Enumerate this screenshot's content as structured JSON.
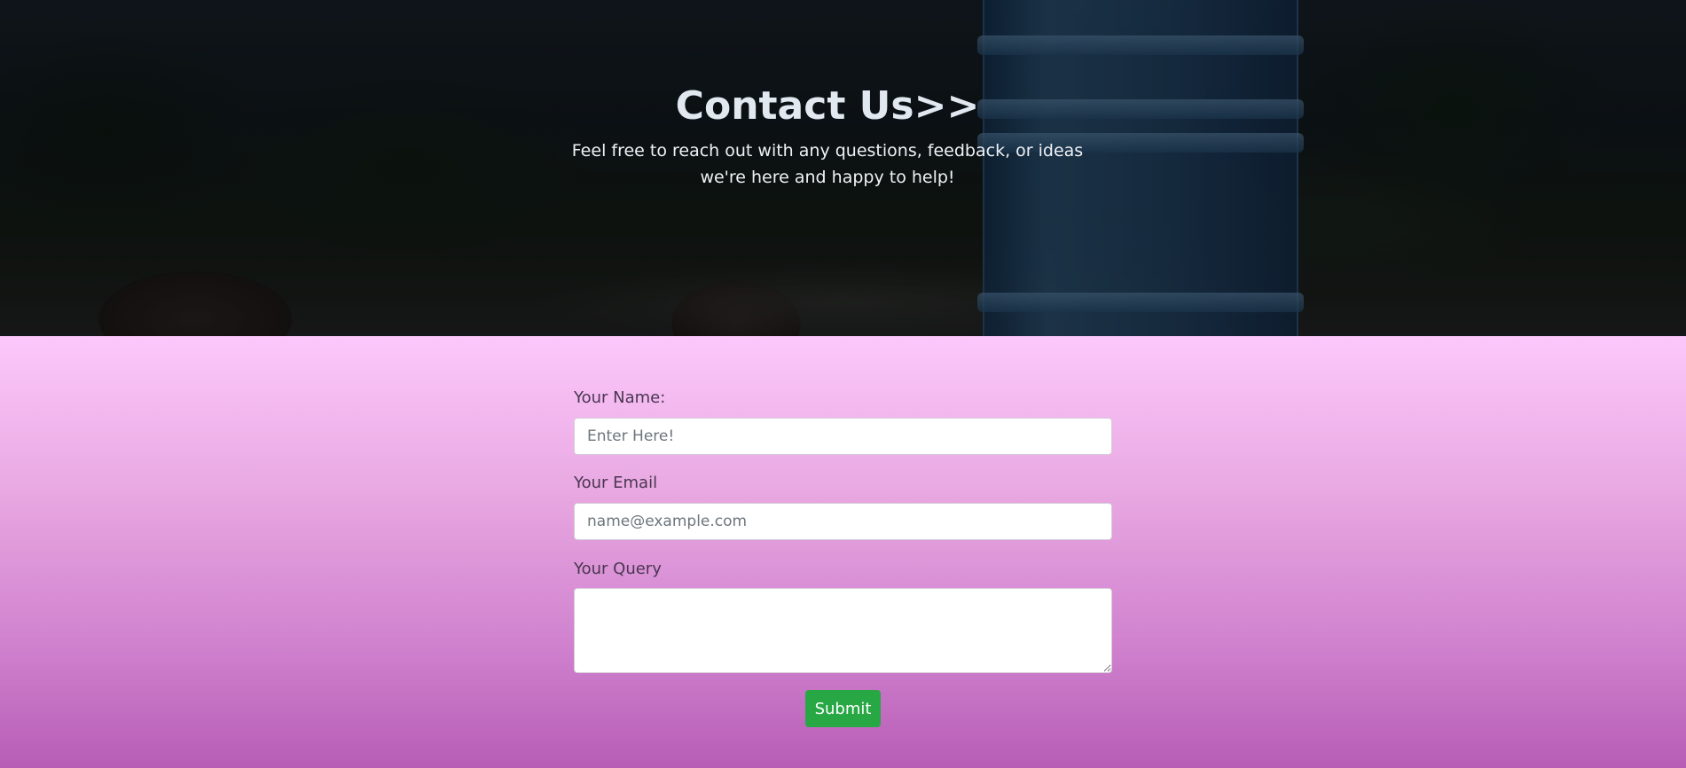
{
  "hero": {
    "title": "Contact Us>>",
    "subtitle": "Feel free to reach out with any questions, feedback, or ideas we're here and happy to help!"
  },
  "form": {
    "name_label": "Your Name:",
    "name_placeholder": "Enter Here!",
    "email_label": "Your Email",
    "email_placeholder": "name@example.com",
    "query_label": "Your Query",
    "submit_label": "Submit"
  },
  "colors": {
    "submit_button": "#28a745",
    "form_gradient_top": "#fcc8fc",
    "form_gradient_bottom": "#b75db6"
  }
}
